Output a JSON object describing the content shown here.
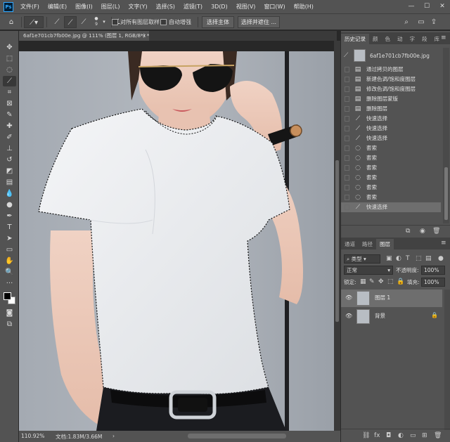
{
  "menu": {
    "logo": "Ps",
    "items": [
      "文件(F)",
      "编辑(E)",
      "图像(I)",
      "图层(L)",
      "文字(Y)",
      "选择(S)",
      "滤镜(T)",
      "3D(D)",
      "视图(V)",
      "窗口(W)",
      "帮助(H)"
    ],
    "window_controls": [
      "—",
      "☐",
      "✕"
    ]
  },
  "options": {
    "brush_size": "9",
    "sample_all_layers": "对所有图层取样",
    "auto_enhance": "自动增强",
    "select_subject": "选择主体",
    "select_and_mask": "选择并遮住 ..."
  },
  "document": {
    "tab_title": "6af1e701cb7fb00e.jpg @ 111% (图层 1, RGB/8*) *",
    "close": "×"
  },
  "status": {
    "zoom": "110.92%",
    "doc_info": "文档:1.83M/3.66M",
    "arrow": "›"
  },
  "history": {
    "tabs": [
      "历史记录",
      "颜",
      "色",
      "动",
      "字",
      "段",
      "库"
    ],
    "snapshot_name": "6af1e701cb7fb00e.jpg",
    "items": [
      {
        "icon": "document-icon",
        "label": "通过拷贝的图层"
      },
      {
        "icon": "document-icon",
        "label": "新建色调/饱和度图层"
      },
      {
        "icon": "document-icon",
        "label": "修改色调/饱和度图层"
      },
      {
        "icon": "document-icon",
        "label": "删除图层蒙版"
      },
      {
        "icon": "document-icon",
        "label": "删除图层"
      },
      {
        "icon": "quick-select-icon",
        "label": "快速选择"
      },
      {
        "icon": "quick-select-icon",
        "label": "快速选择"
      },
      {
        "icon": "quick-select-icon",
        "label": "快速选择"
      },
      {
        "icon": "lasso-icon",
        "label": "套索"
      },
      {
        "icon": "lasso-icon",
        "label": "套索"
      },
      {
        "icon": "lasso-icon",
        "label": "套索"
      },
      {
        "icon": "lasso-icon",
        "label": "套索"
      },
      {
        "icon": "lasso-icon",
        "label": "套索"
      },
      {
        "icon": "lasso-icon",
        "label": "套索"
      },
      {
        "icon": "quick-select-icon",
        "label": "快速选择"
      }
    ]
  },
  "layers_panel": {
    "tabs": [
      "通道",
      "路径",
      "图层"
    ],
    "filter_kind": "类型",
    "blend_mode": "正常",
    "opacity_label": "不透明度:",
    "opacity_value": "100%",
    "lock_label": "锁定:",
    "fill_label": "填充:",
    "fill_value": "100%",
    "layers": [
      {
        "name": "图层 1",
        "selected": true
      },
      {
        "name": "背景",
        "selected": false,
        "locked": true
      }
    ]
  }
}
